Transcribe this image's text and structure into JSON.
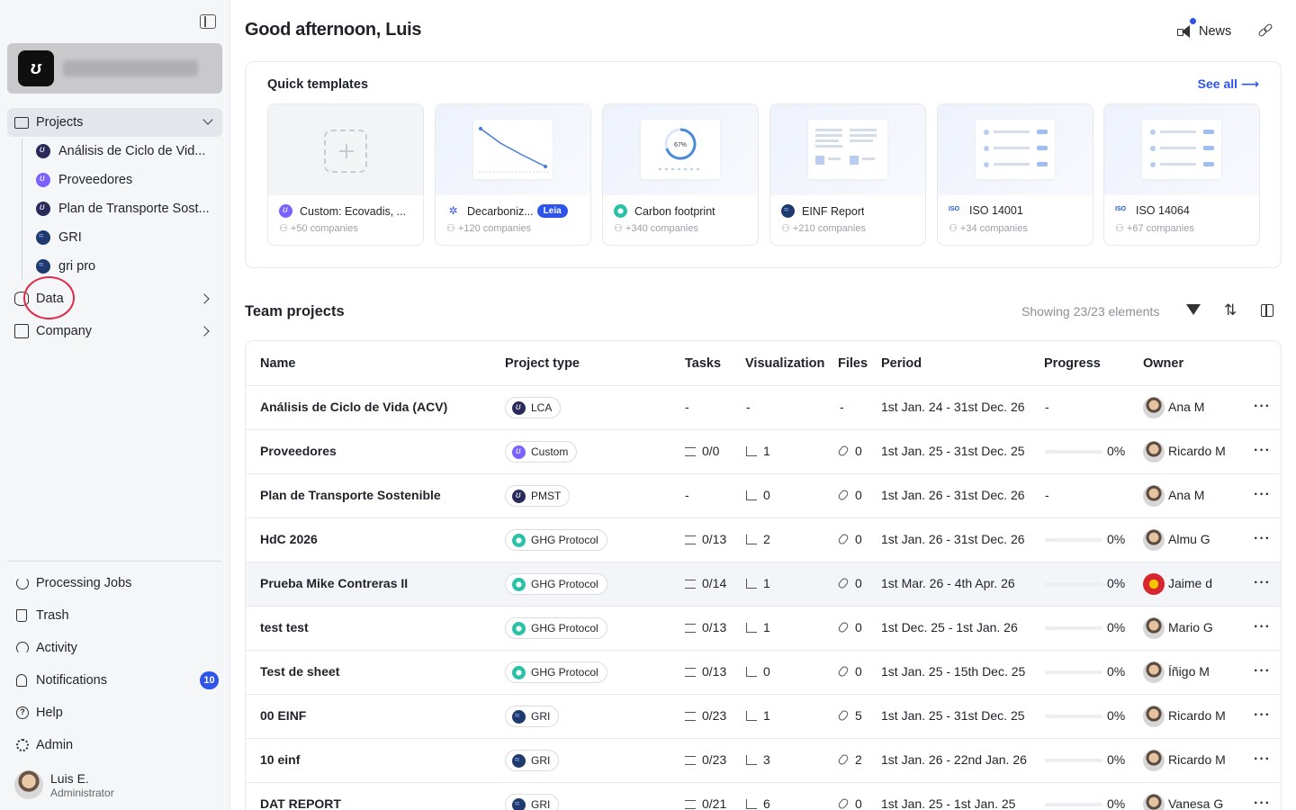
{
  "sidebar": {
    "projects_label": "Projects",
    "project_items": [
      {
        "label": "Análisis de Ciclo de Vid...",
        "icon": "dark"
      },
      {
        "label": "Proveedores",
        "icon": "purple"
      },
      {
        "label": "Plan de Transporte Sost...",
        "icon": "dark"
      },
      {
        "label": "GRI",
        "icon": "gri"
      },
      {
        "label": "gri pro",
        "icon": "gri"
      }
    ],
    "data_label": "Data",
    "company_label": "Company",
    "bottom": {
      "processing": "Processing Jobs",
      "trash": "Trash",
      "activity": "Activity",
      "notifications": "Notifications",
      "notifications_count": "10",
      "help": "Help",
      "admin": "Admin"
    },
    "user": {
      "name": "Luis E.",
      "role": "Administrator"
    }
  },
  "header": {
    "greeting": "Good afternoon, Luis",
    "news": "News"
  },
  "templates": {
    "title": "Quick templates",
    "see_all": "See all ⟶",
    "items": [
      {
        "name": "Custom: Ecovadis, ...",
        "sub": "+50 companies"
      },
      {
        "name": "Decarboniz...",
        "sub": "+120 companies",
        "badge": "Leia"
      },
      {
        "name": "Carbon footprint",
        "sub": "+340 companies"
      },
      {
        "name": "EINF Report",
        "sub": "+210 companies"
      },
      {
        "name": "ISO 14001",
        "sub": "+34 companies"
      },
      {
        "name": "ISO 14064",
        "sub": "+67 companies"
      }
    ]
  },
  "team": {
    "title": "Team projects",
    "showing": "Showing 23/23 elements",
    "columns": [
      "Name",
      "Project type",
      "Tasks",
      "Visualization",
      "Files",
      "Period",
      "Progress",
      "Owner"
    ],
    "rows": [
      {
        "name": "Análisis de Ciclo de Vida (ACV)",
        "type": "LCA",
        "tasks": "-",
        "viz": "-",
        "files": "-",
        "period": "1st Jan. 24 - 31st Dec. 26",
        "progress": "-",
        "owner": "Ana M"
      },
      {
        "name": "Proveedores",
        "type": "Custom",
        "tasks": "0/0",
        "viz": "1",
        "files": "0",
        "period": "1st Jan. 25 - 31st Dec. 25",
        "progress": "0%",
        "owner": "Ricardo M"
      },
      {
        "name": "Plan de Transporte Sostenible",
        "type": "PMST",
        "tasks": "-",
        "viz": "0",
        "files": "0",
        "period": "1st Jan. 26 - 31st Dec. 26",
        "progress": "-",
        "owner": "Ana M"
      },
      {
        "name": "HdC 2026",
        "type": "GHG Protocol",
        "tasks": "0/13",
        "viz": "2",
        "files": "0",
        "period": "1st Jan. 26 - 31st Dec. 26",
        "progress": "0%",
        "owner": "Almu G"
      },
      {
        "name": "Prueba Mike Contreras II",
        "type": "GHG Protocol",
        "tasks": "0/14",
        "viz": "1",
        "files": "0",
        "period": "1st Mar. 26 - 4th Apr. 26",
        "progress": "0%",
        "owner": "Jaime d"
      },
      {
        "name": "test test",
        "type": "GHG Protocol",
        "tasks": "0/13",
        "viz": "1",
        "files": "0",
        "period": "1st Dec. 25 - 1st Jan. 26",
        "progress": "0%",
        "owner": "Mario G"
      },
      {
        "name": "Test de sheet",
        "type": "GHG Protocol",
        "tasks": "0/13",
        "viz": "0",
        "files": "0",
        "period": "1st Jan. 25 - 15th Dec. 25",
        "progress": "0%",
        "owner": "Íñigo M"
      },
      {
        "name": "00 EINF",
        "type": "GRI",
        "tasks": "0/23",
        "viz": "1",
        "files": "5",
        "period": "1st Jan. 25 - 31st Dec. 25",
        "progress": "0%",
        "owner": "Ricardo M"
      },
      {
        "name": "10 einf",
        "type": "GRI",
        "tasks": "0/23",
        "viz": "3",
        "files": "2",
        "period": "1st Jan. 26 - 22nd Jan. 26",
        "progress": "0%",
        "owner": "Ricardo M"
      },
      {
        "name": "DAT REPORT",
        "type": "GRI",
        "tasks": "0/21",
        "viz": "6",
        "files": "0",
        "period": "1st Jan. 25 - 1st Jan. 25",
        "progress": "0%",
        "owner": "Vanesa G"
      }
    ]
  },
  "colors": {
    "accent": "#2f54eb",
    "highlight_circle": "#e0294a"
  }
}
